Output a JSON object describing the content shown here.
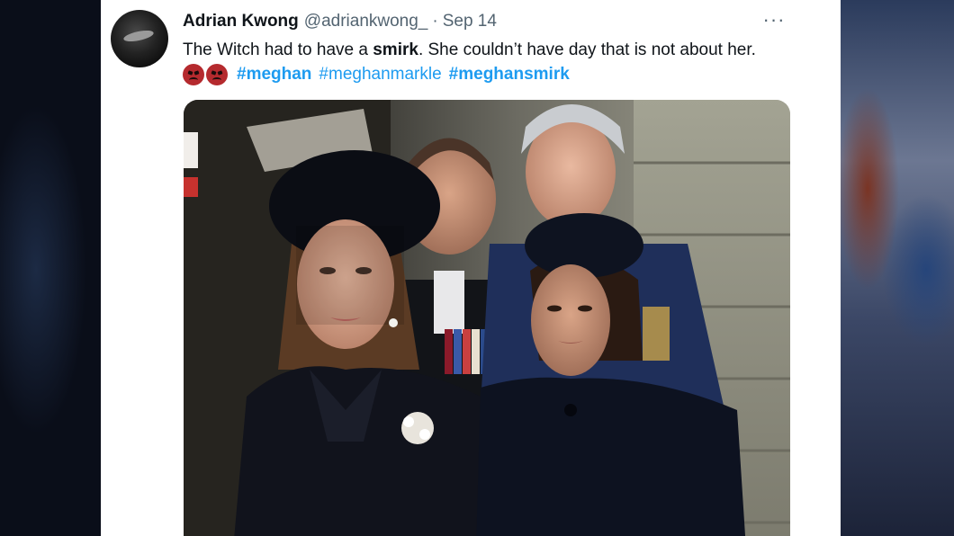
{
  "tweet": {
    "author_name": "Adrian Kwong",
    "author_handle": "@adriankwong_",
    "separator": "·",
    "date": "Sep 14",
    "more_icon": "···",
    "text_before_bold": "The Witch had to have a ",
    "text_bold": "smirk",
    "text_after_bold": ". She couldn’t have day that is not about her.",
    "emojis": [
      "angry-face-icon",
      "angry-face-icon"
    ],
    "hashtags": [
      {
        "text": "#meghan",
        "bold": true
      },
      {
        "text": "#meghanmarkle",
        "bold": false
      },
      {
        "text": "#meghansmirk",
        "bold": true
      }
    ],
    "photo_description_icon": "photo-of-two-women-in-black-mourning-attire"
  },
  "colors": {
    "link": "#1d9bf0",
    "text": "#0f1419",
    "secondary": "#536471"
  }
}
